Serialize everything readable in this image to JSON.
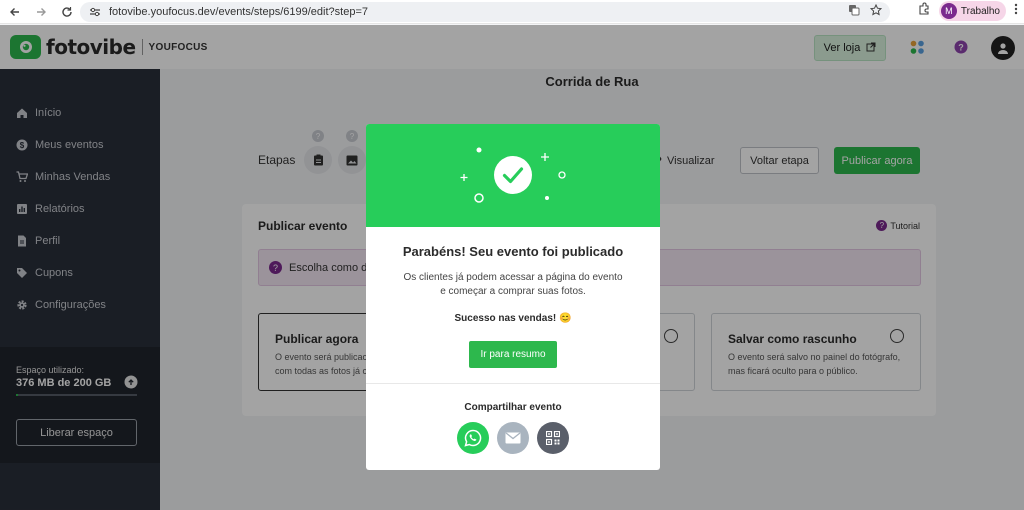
{
  "browser": {
    "url": "fotovibe.youfocus.dev/events/steps/6199/edit?step=7",
    "profile_initial": "M",
    "profile_name": "Trabalho"
  },
  "header": {
    "logo_text": "fotovibe",
    "logo_sub": "YOUFOCUS",
    "ver_loja_label": "Ver loja"
  },
  "sidebar": {
    "items": [
      {
        "label": "Início",
        "icon": "home-icon"
      },
      {
        "label": "Meus eventos",
        "icon": "dollar-circle-icon"
      },
      {
        "label": "Minhas Vendas",
        "icon": "cart-icon"
      },
      {
        "label": "Relatórios",
        "icon": "bar-chart-icon"
      },
      {
        "label": "Perfil",
        "icon": "document-icon"
      },
      {
        "label": "Cupons",
        "icon": "tag-icon"
      },
      {
        "label": "Configurações",
        "icon": "gear-icon"
      }
    ],
    "storage": {
      "label": "Espaço utilizado:",
      "value": "376 MB de 200 GB",
      "used_fraction": 0.0018,
      "button": "Liberar espaço"
    }
  },
  "main": {
    "title": "Corrida de Rua",
    "steps_label": "Etapas",
    "step_badge_1": "?",
    "step_badge_2": "?",
    "visualizar": "Visualizar",
    "voltar_etapa": "Voltar etapa",
    "publicar_agora": "Publicar agora",
    "card": {
      "title": "Publicar evento",
      "tutorial": "Tutorial",
      "info": "Escolha como des",
      "options": [
        {
          "title": "Publicar agora",
          "desc1": "O evento será publicac",
          "desc2": "com todas as fotos já c"
        },
        {
          "title": "Salvar como rascunho",
          "desc1": "O evento será salvo no painel do fotógrafo,",
          "desc2": "mas ficará oculto para o público."
        }
      ]
    }
  },
  "modal": {
    "title": "Parabéns! Seu evento foi publicado",
    "desc1": "Os clientes já podem acessar a página do evento",
    "desc2": "e começar a comprar suas fotos.",
    "success": "Sucesso nas vendas! 😊",
    "button": "Ir para resumo",
    "share_title": "Compartilhar evento",
    "colors": {
      "banner": "#27cd5a",
      "whatsapp": "#27cd5a",
      "email": "#a9b4bf",
      "qr": "#5a5f6a"
    }
  }
}
